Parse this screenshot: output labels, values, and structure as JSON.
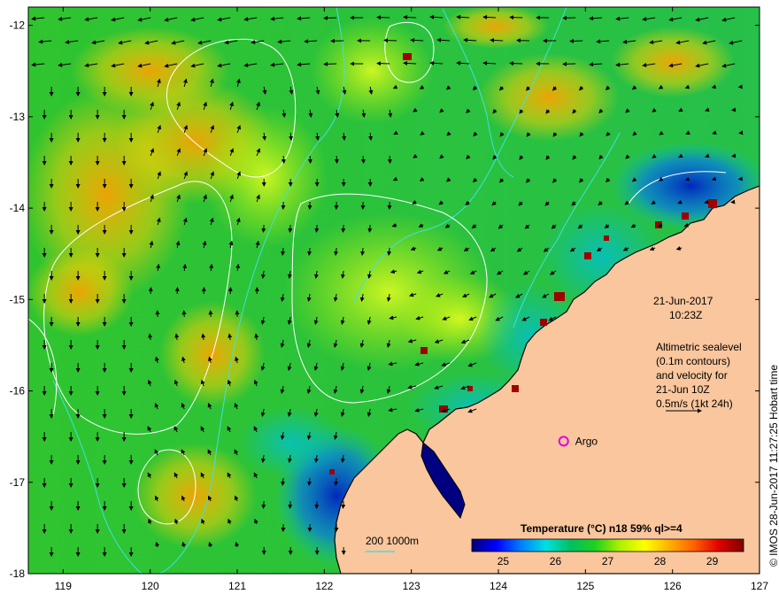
{
  "map": {
    "lon_range": [
      118.6,
      127.0
    ],
    "lat_range": [
      -18.0,
      -11.8
    ],
    "x_ticks": [
      119,
      120,
      121,
      122,
      123,
      124,
      125,
      126,
      127
    ],
    "y_ticks": [
      -12,
      -13,
      -14,
      -15,
      -16,
      -17,
      -18
    ]
  },
  "annotations": {
    "date": "21-Jun-2017",
    "time": "10:23Z",
    "desc_line1": "Altimetric sealevel",
    "desc_line2": "(0.1m contours)",
    "desc_line3": "and velocity for",
    "desc_line4": "21-Jun 10Z",
    "desc_line5": "0.5m/s (1kt 24h)"
  },
  "argo": {
    "label": "Argo",
    "lon": 124.75,
    "lat": -16.55,
    "color": "#e000e0"
  },
  "bathy_legend": {
    "label": "200  1000m"
  },
  "colorbar": {
    "title": "Temperature (°C) n18 59% ql>=4",
    "min": 24.4,
    "max": 29.6,
    "ticks": [
      "25",
      "26",
      "27",
      "28",
      "29"
    ],
    "colors": [
      "#00007a",
      "#0000ff",
      "#0080ff",
      "#00e0e0",
      "#00c060",
      "#20d020",
      "#b0f000",
      "#ffff00",
      "#ffb000",
      "#ff6000",
      "#e00000",
      "#800000"
    ]
  },
  "credit": "© IMOS 28-Jun-2017 11:27:25 Hobart time",
  "colors": {
    "land": "#f9c69d",
    "coast": "#000000",
    "contour": "#ffffff",
    "bathy": "#40e0e0"
  }
}
